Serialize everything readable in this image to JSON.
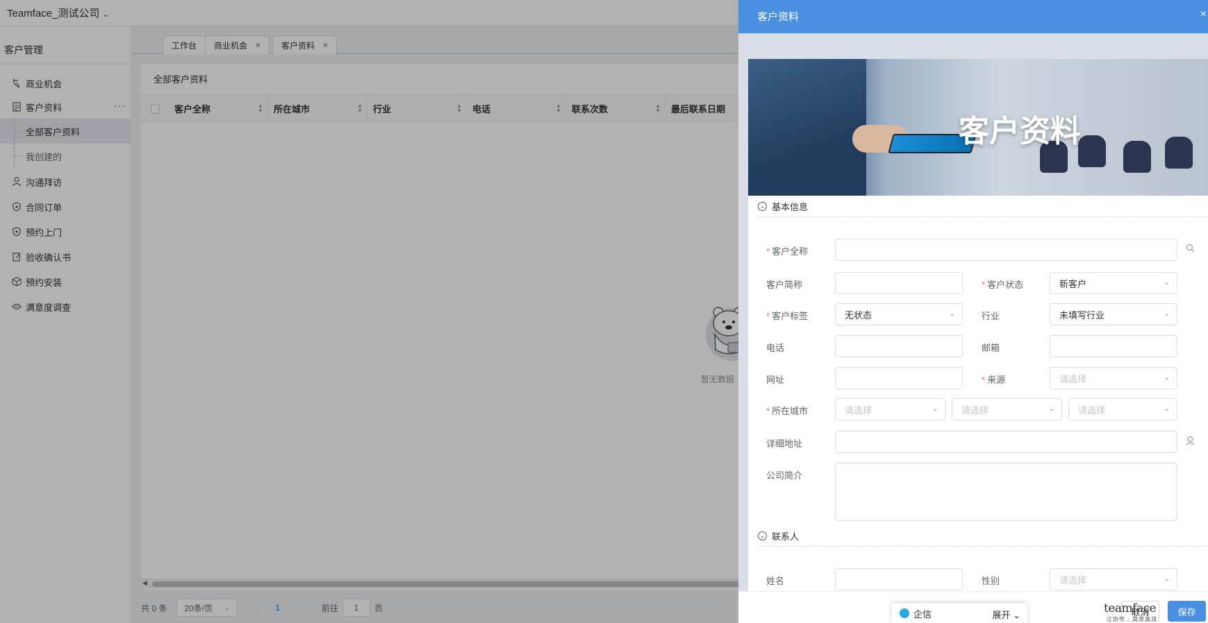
{
  "app": {
    "company": "Teamface_测试公司"
  },
  "sidebar": {
    "module_title": "客户管理",
    "items": [
      {
        "label": "商业机会",
        "icon": "opportunity-icon"
      },
      {
        "label": "客户资料",
        "icon": "document-icon",
        "more": "···"
      },
      {
        "label": "全部客户资料",
        "sub": true,
        "active": true
      },
      {
        "label": "我创建的",
        "sub": true
      },
      {
        "label": "沟通拜访",
        "icon": "visit-icon"
      },
      {
        "label": "合同订单",
        "icon": "shield-icon"
      },
      {
        "label": "预约上门",
        "icon": "shield-icon"
      },
      {
        "label": "验收确认书",
        "icon": "edit-doc-icon"
      },
      {
        "label": "预约安装",
        "icon": "box-icon"
      },
      {
        "label": "满意度调查",
        "icon": "survey-icon"
      }
    ]
  },
  "tabs": [
    {
      "label": "工作台",
      "closable": false
    },
    {
      "label": "商业机会",
      "closable": true,
      "close": "×"
    },
    {
      "label": "客户资料",
      "closable": true,
      "close": "×"
    }
  ],
  "list": {
    "title": "全部客户资料",
    "columns": [
      "客户全称",
      "所在城市",
      "行业",
      "电话",
      "联系次数",
      "最后联系日期"
    ],
    "empty_text": "暂无数据"
  },
  "pager": {
    "total": "共 0 条",
    "page_size": "20条/页",
    "current_page": "1",
    "goto_prefix": "前往",
    "goto_value": "1",
    "goto_suffix": "页"
  },
  "drawer": {
    "title": "客户资料",
    "close": "×",
    "banner_title": "客户资料",
    "section_basic": "基本信息",
    "section_contact": "联系人",
    "fields": {
      "full_name": {
        "label": "客户全称",
        "value": ""
      },
      "short_name": {
        "label": "客户简称",
        "value": ""
      },
      "status": {
        "label": "客户状态",
        "value": "新客户"
      },
      "tag": {
        "label": "客户标签",
        "value": "无状态"
      },
      "industry": {
        "label": "行业",
        "value": "未填写行业"
      },
      "phone": {
        "label": "电话",
        "value": ""
      },
      "email": {
        "label": "邮箱",
        "value": ""
      },
      "website": {
        "label": "网址",
        "value": ""
      },
      "source": {
        "label": "来源",
        "placeholder": "请选择"
      },
      "city": {
        "label": "所在城市",
        "placeholder": "请选择"
      },
      "address": {
        "label": "详细地址",
        "value": ""
      },
      "intro": {
        "label": "公司简介",
        "value": ""
      },
      "contact_name": {
        "label": "姓名",
        "value": ""
      },
      "gender": {
        "label": "性别",
        "placeholder": "请选择"
      }
    },
    "footer": {
      "chat_label": "企信",
      "expand_label": "展开",
      "brand": "teamface",
      "brand_sub": "让协作 · 简单高效",
      "cancel": "取消",
      "save": "保存"
    }
  },
  "colors": {
    "primary": "#4a90e2",
    "required": "#f56c6c"
  }
}
